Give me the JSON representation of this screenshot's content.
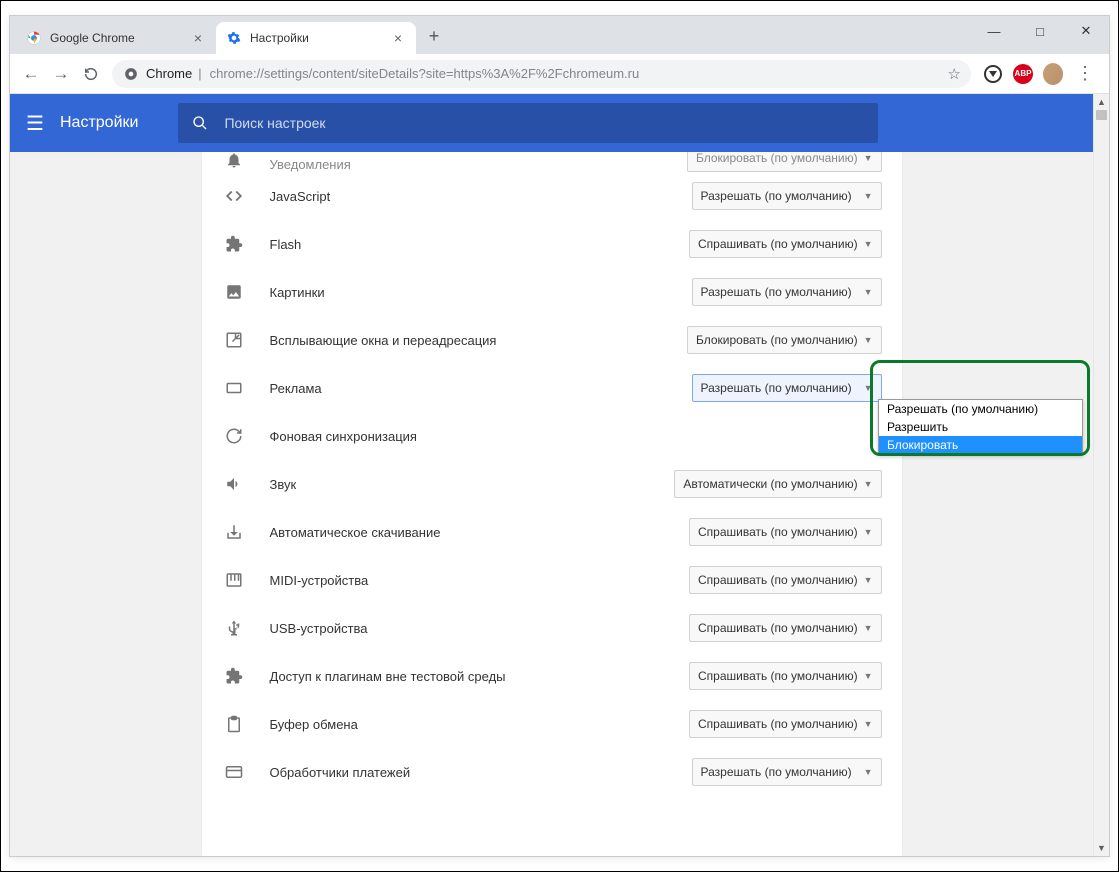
{
  "window": {
    "min": "—",
    "max": "□",
    "close": "✕"
  },
  "tabs": [
    {
      "label": "Google Chrome"
    },
    {
      "label": "Настройки"
    }
  ],
  "toolbar": {
    "host": "Chrome",
    "path": "chrome://settings/content/siteDetails?site=https%3A%2F%2Fchromeum.ru"
  },
  "header": {
    "title": "Настройки",
    "search_placeholder": "Поиск настроек"
  },
  "permissions": [
    {
      "icon": "bell",
      "label": "Уведомления",
      "value": "Блокировать (по умолчанию)",
      "partial": true
    },
    {
      "icon": "code",
      "label": "JavaScript",
      "value": "Разрешать (по умолчанию)"
    },
    {
      "icon": "puzzle",
      "label": "Flash",
      "value": "Спрашивать (по умолчанию)"
    },
    {
      "icon": "image",
      "label": "Картинки",
      "value": "Разрешать (по умолчанию)"
    },
    {
      "icon": "popup",
      "label": "Всплывающие окна и переадресация",
      "value": "Блокировать (по умолчанию)"
    },
    {
      "icon": "ads",
      "label": "Реклама",
      "value": "Разрешать (по умолчанию)",
      "active": true
    },
    {
      "icon": "sync",
      "label": "Фоновая синхронизация",
      "value": ""
    },
    {
      "icon": "sound",
      "label": "Звук",
      "value": "Автоматически (по умолчанию)"
    },
    {
      "icon": "download",
      "label": "Автоматическое скачивание",
      "value": "Спрашивать (по умолчанию)"
    },
    {
      "icon": "midi",
      "label": "MIDI-устройства",
      "value": "Спрашивать (по умолчанию)"
    },
    {
      "icon": "usb",
      "label": "USB-устройства",
      "value": "Спрашивать (по умолчанию)"
    },
    {
      "icon": "puzzle",
      "label": "Доступ к плагинам вне тестовой среды",
      "value": "Спрашивать (по умолчанию)"
    },
    {
      "icon": "clipboard",
      "label": "Буфер обмена",
      "value": "Спрашивать (по умолчанию)"
    },
    {
      "icon": "card",
      "label": "Обработчики платежей",
      "value": "Разрешать (по умолчанию)"
    }
  ],
  "dropdown": {
    "options": [
      "Разрешать (по умолчанию)",
      "Разрешить",
      "Блокировать"
    ],
    "selected": "Блокировать"
  }
}
